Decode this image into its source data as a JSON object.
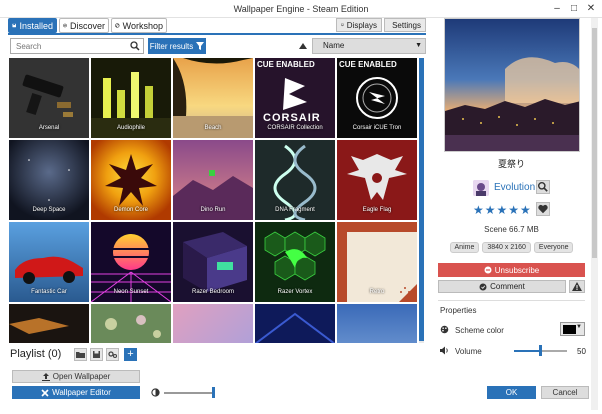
{
  "window": {
    "title": "Wallpaper Engine - Steam Edition",
    "controls": [
      "–",
      "□",
      "✕"
    ]
  },
  "tabs": [
    {
      "label": "Installed",
      "icon": "installed-icon",
      "active": true
    },
    {
      "label": "Discover",
      "icon": "discover-icon",
      "active": false
    },
    {
      "label": "Workshop",
      "icon": "workshop-icon",
      "active": false
    }
  ],
  "top_buttons": {
    "displays": "Displays",
    "settings": "Settings"
  },
  "toolbar": {
    "search_placeholder": "Search",
    "filter_label": "Filter results",
    "sort_selected": "Name"
  },
  "grid": {
    "items": [
      {
        "label": "Arsenal"
      },
      {
        "label": "Audiophile"
      },
      {
        "label": "Beach"
      },
      {
        "label": "CORSAIR Collection"
      },
      {
        "label": "Corsair iCUE Tron"
      },
      {
        "label": "Deep Space"
      },
      {
        "label": "Demon Core"
      },
      {
        "label": "Dino Run"
      },
      {
        "label": "DNA Fragment"
      },
      {
        "label": "Eagle Flag"
      },
      {
        "label": "Fantastic Car"
      },
      {
        "label": "Neon Sunset"
      },
      {
        "label": "Razer Bedroom"
      },
      {
        "label": "Razer Vortex"
      },
      {
        "label": "Retro"
      },
      {
        "label": ""
      },
      {
        "label": ""
      },
      {
        "label": ""
      },
      {
        "label": ""
      },
      {
        "label": ""
      }
    ],
    "art_text": {
      "cue_enabled": "CUE ENABLED",
      "corsair": "CORSAIR"
    }
  },
  "playlist": {
    "label": "Playlist (0)"
  },
  "bottom": {
    "open_wallpaper": "Open Wallpaper",
    "wallpaper_editor": "Wallpaper Editor",
    "brightness_level": 1.0,
    "ok": "OK",
    "cancel": "Cancel"
  },
  "details": {
    "title": "夏祭り",
    "author": "Evolution",
    "rating": "★★★★★",
    "rating_value": 5,
    "meta": "Scene  66.7 MB",
    "tags": [
      "Anime",
      "3840 x 2160",
      "Everyone"
    ],
    "unsubscribe": "Unsubscribe",
    "comment": "Comment"
  },
  "properties": {
    "heading": "Properties",
    "scheme_color_label": "Scheme color",
    "scheme_color": "#000000",
    "volume_label": "Volume",
    "volume_value": "50",
    "volume_fraction": 0.5
  },
  "colors": {
    "accent": "#2a72b8",
    "danger": "#d9534f"
  }
}
